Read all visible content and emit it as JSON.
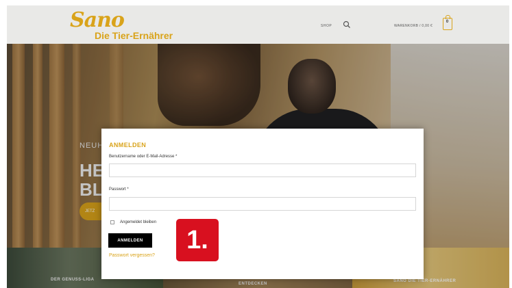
{
  "brand": {
    "logo": "Sano",
    "tagline": "Die Tier-Ernährer",
    "color_gold": "#d9a31a"
  },
  "header": {
    "shop_label": "SHOP",
    "cart_label": "WARENKORB / 0,00 €",
    "cart_count": "0",
    "search_icon": "search-icon",
    "cart_icon": "bag-icon"
  },
  "hero": {
    "line1": "NEUH",
    "line2": "HE",
    "line3": "BL",
    "button_label": "JETZ"
  },
  "tiles": [
    {
      "label": "DER GENUSS-LIGA"
    },
    {
      "label": "ENTDECKEN"
    },
    {
      "label": "SANO DIE TIER-ERNÄHRER"
    }
  ],
  "login": {
    "title": "ANMELDEN",
    "username_label": "Benutzername oder E-Mail-Adresse *",
    "username_value": "",
    "password_label": "Passwort *",
    "password_value": "",
    "remember_label": "Angemeldet bleiben",
    "submit_label": "ANMELDEN",
    "lost_password": "Passwort vergessen?"
  },
  "annotation": {
    "step_label": "1.",
    "color": "#d8101f"
  }
}
